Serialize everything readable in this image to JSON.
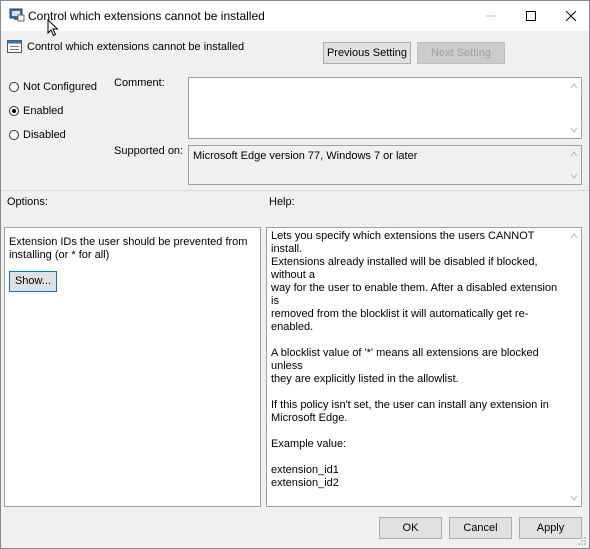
{
  "window": {
    "title": "Control which extensions cannot be installed"
  },
  "policy": {
    "name": "Control which extensions cannot be installed"
  },
  "nav": {
    "previous_label": "Previous Setting",
    "next_label": "Next Setting"
  },
  "state": {
    "options": [
      {
        "label": "Not Configured",
        "checked": false
      },
      {
        "label": "Enabled",
        "checked": true
      },
      {
        "label": "Disabled",
        "checked": false
      }
    ]
  },
  "comment": {
    "label": "Comment:",
    "value": ""
  },
  "supported": {
    "label": "Supported on:",
    "value": "Microsoft Edge version 77, Windows 7 or later"
  },
  "options_panel": {
    "header": "Options:",
    "line1": "Extension IDs the user should be prevented from",
    "line2": "installing (or * for all)",
    "show_label": "Show..."
  },
  "help_panel": {
    "header": "Help:",
    "para1_l1": "Lets you specify which extensions the users CANNOT install.",
    "para1_l2": "Extensions already installed will be disabled if blocked, without a",
    "para1_l3": "way for the user to enable them. After a disabled extension is",
    "para1_l4": "removed from the blocklist it will automatically get re-enabled.",
    "para2_l1": "A blocklist value of '*' means all extensions are blocked unless",
    "para2_l2": "they are explicitly listed in the allowlist.",
    "para3_l1": "If this policy isn't set, the user can install any extension in",
    "para3_l2": "Microsoft Edge.",
    "para4": "Example value:",
    "example1": "extension_id1",
    "example2": "extension_id2"
  },
  "footer": {
    "ok_label": "OK",
    "cancel_label": "Cancel",
    "apply_label": "Apply"
  }
}
